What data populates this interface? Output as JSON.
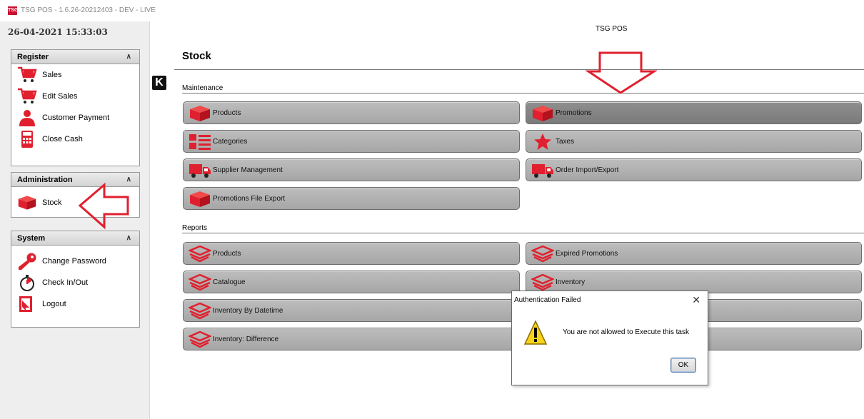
{
  "window": {
    "title": "TSG POS - 1.6.26-20212403 - DEV - LIVE",
    "app_badge": "TSG"
  },
  "clock": "26-04-2021 15:33:03",
  "header": {
    "title": "TSG POS"
  },
  "sidebar": {
    "register": {
      "title": "Register",
      "items": [
        {
          "label": "Sales",
          "icon": "cart-icon"
        },
        {
          "label": "Edit Sales",
          "icon": "cart-edit-icon"
        },
        {
          "label": "Customer Payment",
          "icon": "customer-icon"
        },
        {
          "label": "Close Cash",
          "icon": "calculator-icon"
        }
      ]
    },
    "administration": {
      "title": "Administration",
      "items": [
        {
          "label": "Stock",
          "icon": "box-icon"
        }
      ]
    },
    "system": {
      "title": "System",
      "items": [
        {
          "label": "Change Password",
          "icon": "key-icon"
        },
        {
          "label": "Check In/Out",
          "icon": "stopwatch-icon"
        },
        {
          "label": "Logout",
          "icon": "logout-icon"
        }
      ]
    },
    "collapse_glyph": "«"
  },
  "page": {
    "title": "Stock",
    "logo": "K"
  },
  "maintenance": {
    "label": "Maintenance",
    "buttons": [
      {
        "label": "Products",
        "icon": "box-icon"
      },
      {
        "label": "Promotions",
        "icon": "box-icon"
      },
      {
        "label": "Categories",
        "icon": "list-icon"
      },
      {
        "label": "Taxes",
        "icon": "star-icon"
      },
      {
        "label": "Supplier Management",
        "icon": "truck-icon"
      },
      {
        "label": "Order Import/Export",
        "icon": "truck-icon"
      },
      {
        "label": "Promotions File Export",
        "icon": "box-icon"
      }
    ]
  },
  "reports": {
    "label": "Reports",
    "buttons": [
      {
        "label": "Products",
        "icon": "layers-icon"
      },
      {
        "label": "Expired Promotions",
        "icon": "layers-icon"
      },
      {
        "label": "Catalogue",
        "icon": "layers-icon"
      },
      {
        "label": "Inventory",
        "icon": "layers-icon"
      },
      {
        "label": "Inventory By Datetime",
        "icon": "layers-icon"
      },
      {
        "label": "Inventory: Difference",
        "icon": "layers-icon"
      }
    ]
  },
  "dialog": {
    "title": "Authentication Failed",
    "close": "✕",
    "message": "You are not allowed to Execute this task",
    "ok": "OK",
    "icon": "warning-icon"
  },
  "colors": {
    "brand_red": "#e0202e",
    "button_gray": "#b3b3b3",
    "button_active": "#838383"
  }
}
